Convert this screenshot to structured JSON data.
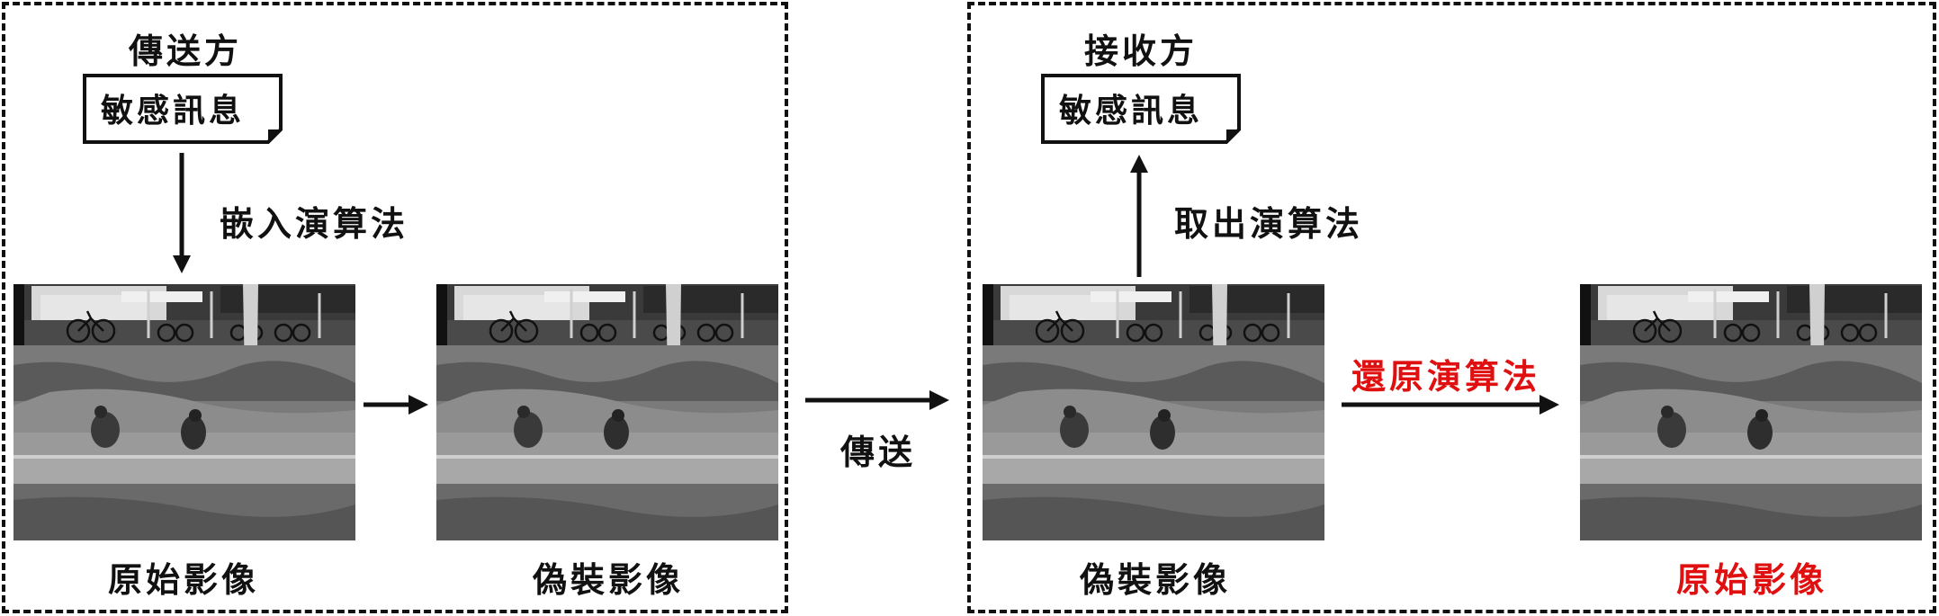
{
  "sender": {
    "title": "傳送方",
    "message": "敏感訊息",
    "embed_label": "嵌入演算法",
    "original_caption": "原始影像",
    "stego_caption": "偽裝影像"
  },
  "transmit_label": "傳送",
  "receiver": {
    "title": "接收方",
    "message": "敏感訊息",
    "extract_label": "取出演算法",
    "restore_label": "還原演算法",
    "stego_caption": "偽裝影像",
    "recovered_caption": "原始影像"
  },
  "colors": {
    "highlight": "#e01010",
    "border": "#111111"
  }
}
